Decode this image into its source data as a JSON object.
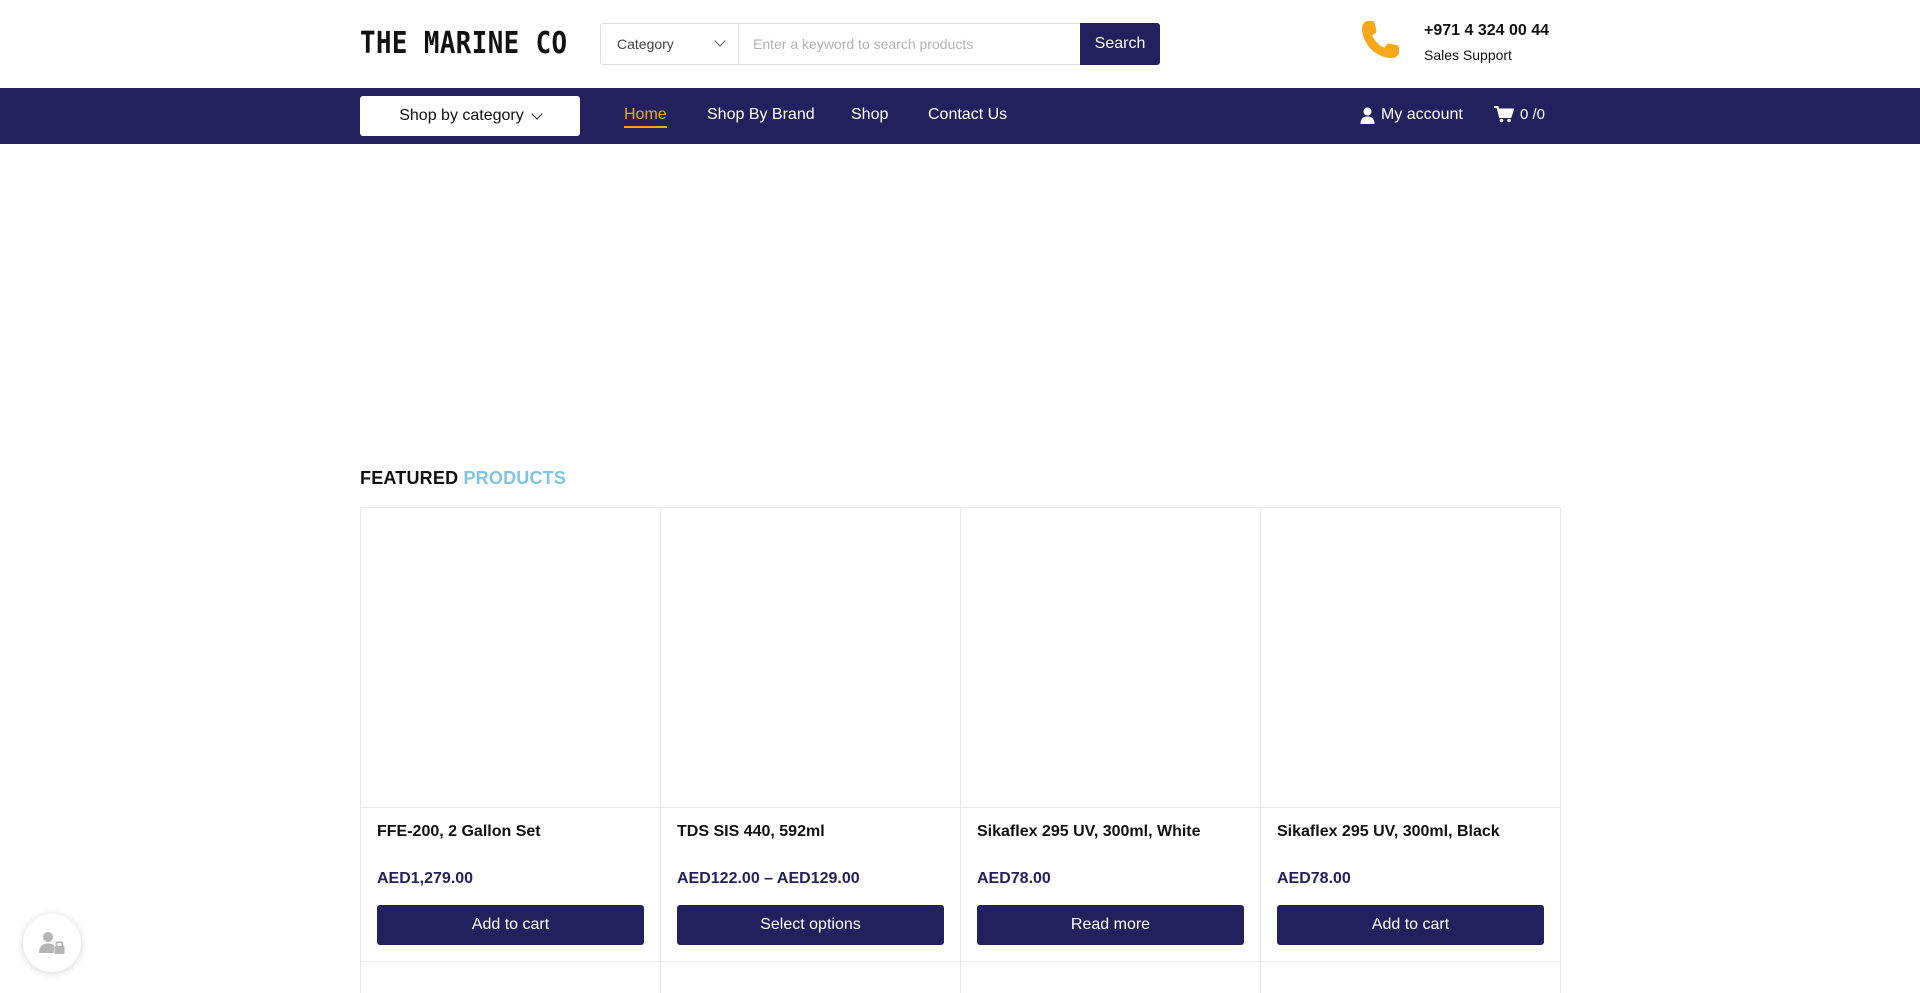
{
  "header": {
    "logo_text": "THE MARINE CO",
    "search": {
      "category_label": "Category",
      "placeholder": "Enter a keyword to search products",
      "button_label": "Search"
    },
    "phone": {
      "number": "+971 4 324 00 44",
      "label": "Sales Support",
      "icon": "phone-icon",
      "icon_color": "#f5a81c"
    }
  },
  "nav": {
    "category_button": "Shop by category",
    "links": [
      "Home",
      "Shop By Brand",
      "Shop",
      "Contact Us"
    ],
    "active_link": "Home",
    "account_label": "My account",
    "cart_label": "0 /0"
  },
  "featured": {
    "title_part1": "FEATURED",
    "title_part2": "PRODUCTS",
    "products": [
      {
        "name": "FFE-200, 2 Gallon Set",
        "price": "AED1,279.00",
        "button": "Add to cart"
      },
      {
        "name": "TDS SIS 440, 592ml",
        "price": "AED122.00 – AED129.00",
        "button": "Select options"
      },
      {
        "name": "Sikaflex 295 UV, 300ml, White",
        "price": "AED78.00",
        "button": "Read more"
      },
      {
        "name": "Sikaflex 295 UV, 300ml, Black",
        "price": "AED78.00",
        "button": "Add to cart"
      }
    ]
  },
  "colors": {
    "brand_navy": "#23215d",
    "accent_orange": "#f5a81c",
    "accent_blue": "#7fc4e8"
  }
}
